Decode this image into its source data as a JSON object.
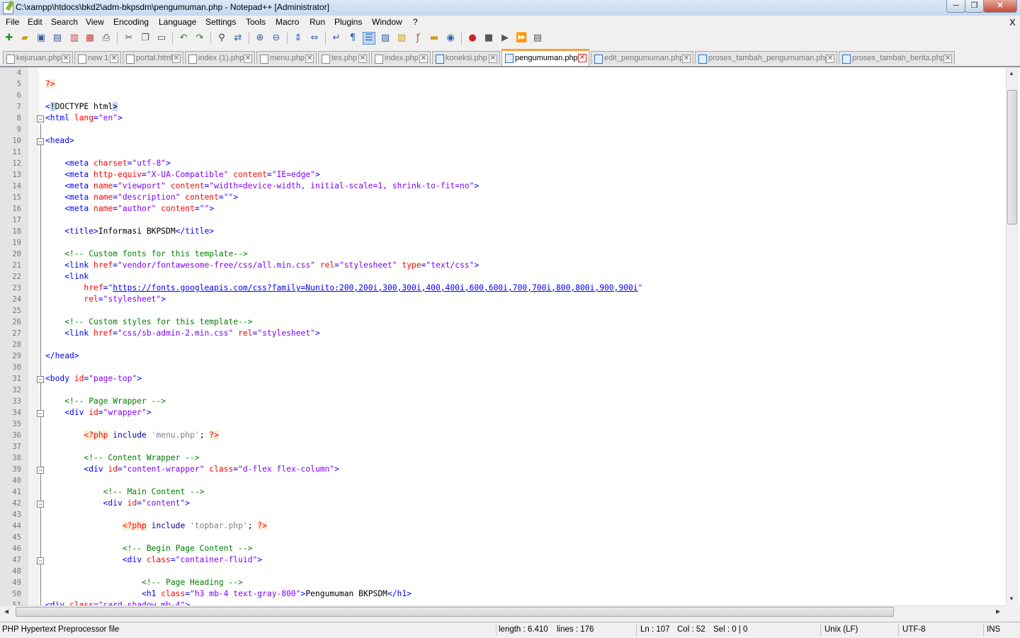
{
  "window": {
    "title": "C:\\xampp\\htdocs\\bkd2\\adm-bkpsdm\\pengumuman.php - Notepad++ [Administrator]",
    "min_label": "─",
    "max_label": "❐",
    "close_label": "✕"
  },
  "menu": {
    "items": [
      "File",
      "Edit",
      "Search",
      "View",
      "Encoding",
      "Language",
      "Settings",
      "Tools",
      "Macro",
      "Run",
      "Plugins",
      "Window",
      "?"
    ],
    "doc_close": "X"
  },
  "toolbar": {
    "icons": [
      "new-file",
      "open-file",
      "save",
      "save-all",
      "close",
      "close-all",
      "print",
      "cut",
      "copy",
      "paste",
      "undo",
      "redo",
      "find",
      "replace",
      "zoom-in",
      "zoom-out",
      "sync-vertical",
      "sync-horizontal",
      "word-wrap",
      "show-all-chars",
      "indent-guide",
      "user-defined-language",
      "document-map",
      "function-list",
      "folder-as-workspace",
      "monitoring",
      "record-macro",
      "stop-recording",
      "playback-macro",
      "run-macro-multiple",
      "save-macro"
    ]
  },
  "tabs": [
    {
      "label": "kejuruan.php",
      "active": false,
      "saved": false
    },
    {
      "label": "new 1",
      "active": false,
      "saved": false
    },
    {
      "label": "portal.html",
      "active": false,
      "saved": false
    },
    {
      "label": "index (1).php",
      "active": false,
      "saved": false
    },
    {
      "label": "menu.php",
      "active": false,
      "saved": false
    },
    {
      "label": "tes.php",
      "active": false,
      "saved": false
    },
    {
      "label": "index.php",
      "active": false,
      "saved": false
    },
    {
      "label": "koneksi.php",
      "active": false,
      "saved": true
    },
    {
      "label": "pengumuman.php",
      "active": true,
      "saved": true
    },
    {
      "label": "edit_pengumuman.php",
      "active": false,
      "saved": true
    },
    {
      "label": "proses_tambah_pengumuman.php",
      "active": false,
      "saved": true
    },
    {
      "label": "proses_tambah_berita.php",
      "active": false,
      "saved": true
    }
  ],
  "editor": {
    "lines": [
      {
        "n": "4",
        "tokens": []
      },
      {
        "n": "5",
        "tokens": [
          [
            "php",
            "?>"
          ]
        ]
      },
      {
        "n": "6",
        "tokens": []
      },
      {
        "n": "7",
        "tokens": [
          [
            "tag",
            "<"
          ],
          [
            "sel",
            "!"
          ],
          [
            "text",
            "DOCTYPE html"
          ],
          [
            "sel",
            ">"
          ]
        ]
      },
      {
        "n": "8",
        "fold": true,
        "tokens": [
          [
            "tag",
            "<html "
          ],
          [
            "attr",
            "lang"
          ],
          [
            "tag",
            "="
          ],
          [
            "str",
            "\"en\""
          ],
          [
            "tag",
            ">"
          ]
        ]
      },
      {
        "n": "9",
        "tokens": []
      },
      {
        "n": "10",
        "fold": true,
        "tokens": [
          [
            "tag",
            "<head>"
          ]
        ]
      },
      {
        "n": "11",
        "tokens": []
      },
      {
        "n": "12",
        "tokens": [
          [
            "text",
            "    "
          ],
          [
            "tag",
            "<meta "
          ],
          [
            "attr",
            "charset"
          ],
          [
            "tag",
            "="
          ],
          [
            "str",
            "\"utf-8\""
          ],
          [
            "tag",
            ">"
          ]
        ]
      },
      {
        "n": "13",
        "tokens": [
          [
            "text",
            "    "
          ],
          [
            "tag",
            "<meta "
          ],
          [
            "attr",
            "http-equiv"
          ],
          [
            "tag",
            "="
          ],
          [
            "str",
            "\"X-UA-Compatible\""
          ],
          [
            "tag",
            " "
          ],
          [
            "attr",
            "content"
          ],
          [
            "tag",
            "="
          ],
          [
            "str",
            "\"IE=edge\""
          ],
          [
            "tag",
            ">"
          ]
        ]
      },
      {
        "n": "14",
        "tokens": [
          [
            "text",
            "    "
          ],
          [
            "tag",
            "<meta "
          ],
          [
            "attr",
            "name"
          ],
          [
            "tag",
            "="
          ],
          [
            "str",
            "\"viewport\""
          ],
          [
            "tag",
            " "
          ],
          [
            "attr",
            "content"
          ],
          [
            "tag",
            "="
          ],
          [
            "str",
            "\"width=device-width, initial-scale=1, shrink-to-fit=no\""
          ],
          [
            "tag",
            ">"
          ]
        ]
      },
      {
        "n": "15",
        "tokens": [
          [
            "text",
            "    "
          ],
          [
            "tag",
            "<meta "
          ],
          [
            "attr",
            "name"
          ],
          [
            "tag",
            "="
          ],
          [
            "str",
            "\"description\""
          ],
          [
            "tag",
            " "
          ],
          [
            "attr",
            "content"
          ],
          [
            "tag",
            "="
          ],
          [
            "str",
            "\"\""
          ],
          [
            "tag",
            ">"
          ]
        ]
      },
      {
        "n": "16",
        "tokens": [
          [
            "text",
            "    "
          ],
          [
            "tag",
            "<meta "
          ],
          [
            "attr",
            "name"
          ],
          [
            "tag",
            "="
          ],
          [
            "str",
            "\"author\""
          ],
          [
            "tag",
            " "
          ],
          [
            "attr",
            "content"
          ],
          [
            "tag",
            "="
          ],
          [
            "str",
            "\"\""
          ],
          [
            "tag",
            ">"
          ]
        ]
      },
      {
        "n": "17",
        "tokens": []
      },
      {
        "n": "18",
        "tokens": [
          [
            "text",
            "    "
          ],
          [
            "tag",
            "<title>"
          ],
          [
            "text",
            "Informasi BKPSDM"
          ],
          [
            "tag",
            "</title>"
          ]
        ]
      },
      {
        "n": "19",
        "tokens": []
      },
      {
        "n": "20",
        "tokens": [
          [
            "text",
            "    "
          ],
          [
            "cmt",
            "<!-- Custom fonts for this template-->"
          ]
        ]
      },
      {
        "n": "21",
        "tokens": [
          [
            "text",
            "    "
          ],
          [
            "tag",
            "<link "
          ],
          [
            "attr",
            "href"
          ],
          [
            "tag",
            "="
          ],
          [
            "str",
            "\"vendor/fontawesome-free/css/all.min.css\""
          ],
          [
            "tag",
            " "
          ],
          [
            "attr",
            "rel"
          ],
          [
            "tag",
            "="
          ],
          [
            "str",
            "\"stylesheet\""
          ],
          [
            "tag",
            " "
          ],
          [
            "attr",
            "type"
          ],
          [
            "tag",
            "="
          ],
          [
            "str",
            "\"text/css\""
          ],
          [
            "tag",
            ">"
          ]
        ]
      },
      {
        "n": "22",
        "tokens": [
          [
            "text",
            "    "
          ],
          [
            "tag",
            "<link"
          ]
        ]
      },
      {
        "n": "23",
        "tokens": [
          [
            "text",
            "        "
          ],
          [
            "attr",
            "href"
          ],
          [
            "tag",
            "="
          ],
          [
            "str",
            "\""
          ],
          [
            "link",
            "https://fonts.googleapis.com/css?family=Nunito:200,200i,300,300i,400,400i,600,600i,700,700i,800,800i,900,900i"
          ],
          [
            "str",
            "\""
          ]
        ]
      },
      {
        "n": "24",
        "tokens": [
          [
            "text",
            "        "
          ],
          [
            "attr",
            "rel"
          ],
          [
            "tag",
            "="
          ],
          [
            "str",
            "\"stylesheet\""
          ],
          [
            "tag",
            ">"
          ]
        ]
      },
      {
        "n": "25",
        "tokens": []
      },
      {
        "n": "26",
        "tokens": [
          [
            "text",
            "    "
          ],
          [
            "cmt",
            "<!-- Custom styles for this template-->"
          ]
        ]
      },
      {
        "n": "27",
        "tokens": [
          [
            "text",
            "    "
          ],
          [
            "tag",
            "<link "
          ],
          [
            "attr",
            "href"
          ],
          [
            "tag",
            "="
          ],
          [
            "str",
            "\"css/sb-admin-2.min.css\""
          ],
          [
            "tag",
            " "
          ],
          [
            "attr",
            "rel"
          ],
          [
            "tag",
            "="
          ],
          [
            "str",
            "\"stylesheet\""
          ],
          [
            "tag",
            ">"
          ]
        ]
      },
      {
        "n": "28",
        "tokens": []
      },
      {
        "n": "29",
        "tokens": [
          [
            "tag",
            "</head>"
          ]
        ]
      },
      {
        "n": "30",
        "tokens": []
      },
      {
        "n": "31",
        "fold": true,
        "tokens": [
          [
            "tag",
            "<body "
          ],
          [
            "attr",
            "id"
          ],
          [
            "tag",
            "="
          ],
          [
            "str",
            "\"page-top\""
          ],
          [
            "tag",
            ">"
          ]
        ]
      },
      {
        "n": "32",
        "tokens": []
      },
      {
        "n": "33",
        "tokens": [
          [
            "text",
            "    "
          ],
          [
            "cmt",
            "<!-- Page Wrapper -->"
          ]
        ]
      },
      {
        "n": "34",
        "fold": true,
        "tokens": [
          [
            "text",
            "    "
          ],
          [
            "tag",
            "<div "
          ],
          [
            "attr",
            "id"
          ],
          [
            "tag",
            "="
          ],
          [
            "str",
            "\"wrapper\""
          ],
          [
            "tag",
            ">"
          ]
        ]
      },
      {
        "n": "35",
        "tokens": []
      },
      {
        "n": "36",
        "tokens": [
          [
            "text",
            "        "
          ],
          [
            "php",
            "<?php"
          ],
          [
            "text",
            " "
          ],
          [
            "kw",
            "include"
          ],
          [
            "text",
            " "
          ],
          [
            "phpstr",
            "'menu.php'"
          ],
          [
            "text",
            "; "
          ],
          [
            "php",
            "?>"
          ]
        ]
      },
      {
        "n": "37",
        "tokens": []
      },
      {
        "n": "38",
        "tokens": [
          [
            "text",
            "        "
          ],
          [
            "cmt",
            "<!-- Content Wrapper -->"
          ]
        ]
      },
      {
        "n": "39",
        "fold": true,
        "tokens": [
          [
            "text",
            "        "
          ],
          [
            "tag",
            "<div "
          ],
          [
            "attr",
            "id"
          ],
          [
            "tag",
            "="
          ],
          [
            "str",
            "\"content-wrapper\""
          ],
          [
            "tag",
            " "
          ],
          [
            "attr",
            "class"
          ],
          [
            "tag",
            "="
          ],
          [
            "str",
            "\"d-flex flex-column\""
          ],
          [
            "tag",
            ">"
          ]
        ]
      },
      {
        "n": "40",
        "tokens": []
      },
      {
        "n": "41",
        "tokens": [
          [
            "text",
            "            "
          ],
          [
            "cmt",
            "<!-- Main Content -->"
          ]
        ]
      },
      {
        "n": "42",
        "fold": true,
        "tokens": [
          [
            "text",
            "            "
          ],
          [
            "tag",
            "<div "
          ],
          [
            "attr",
            "id"
          ],
          [
            "tag",
            "="
          ],
          [
            "str",
            "\"content\""
          ],
          [
            "tag",
            ">"
          ]
        ]
      },
      {
        "n": "43",
        "tokens": []
      },
      {
        "n": "44",
        "tokens": [
          [
            "text",
            "                "
          ],
          [
            "php",
            "<?php"
          ],
          [
            "text",
            " "
          ],
          [
            "kw",
            "include"
          ],
          [
            "text",
            " "
          ],
          [
            "phpstr",
            "'topbar.php'"
          ],
          [
            "text",
            "; "
          ],
          [
            "php",
            "?>"
          ]
        ]
      },
      {
        "n": "45",
        "tokens": []
      },
      {
        "n": "46",
        "tokens": [
          [
            "text",
            "                "
          ],
          [
            "cmt",
            "<!-- Begin Page Content -->"
          ]
        ]
      },
      {
        "n": "47",
        "fold": true,
        "tokens": [
          [
            "text",
            "                "
          ],
          [
            "tag",
            "<div "
          ],
          [
            "attr",
            "class"
          ],
          [
            "tag",
            "="
          ],
          [
            "str",
            "\"container-fluid\""
          ],
          [
            "tag",
            ">"
          ]
        ]
      },
      {
        "n": "48",
        "tokens": []
      },
      {
        "n": "49",
        "tokens": [
          [
            "text",
            "                    "
          ],
          [
            "cmt",
            "<!-- Page Heading -->"
          ]
        ]
      },
      {
        "n": "50",
        "tokens": [
          [
            "text",
            "                    "
          ],
          [
            "tag",
            "<h1 "
          ],
          [
            "attr",
            "class"
          ],
          [
            "tag",
            "="
          ],
          [
            "str",
            "\"h3 mb-4 text-gray-800\""
          ],
          [
            "tag",
            ">"
          ],
          [
            "text",
            "Pengumuman BKPSDM"
          ],
          [
            "tag",
            "</h1>"
          ]
        ]
      },
      {
        "n": "51",
        "tokens": [
          [
            "tag",
            "<div "
          ],
          [
            "attr",
            "class"
          ],
          [
            "tag",
            "="
          ],
          [
            "str",
            "\"card shadow mb-4\""
          ],
          [
            "tag",
            ">"
          ]
        ]
      }
    ]
  },
  "statusbar": {
    "file_type": "PHP Hypertext Preprocessor file",
    "length": "length : 6.410",
    "lines": "lines : 176",
    "ln": "Ln : 107",
    "col": "Col : 52",
    "sel": "Sel : 0 | 0",
    "eol": "Unix (LF)",
    "encoding": "UTF-8",
    "mode": "INS"
  }
}
